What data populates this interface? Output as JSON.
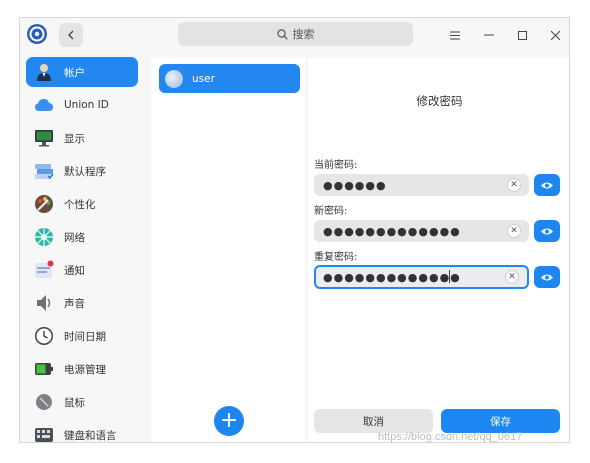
{
  "titlebar": {
    "search_placeholder": "搜索",
    "back_icon": "chevron-left-icon",
    "menu_icon": "menu-icon",
    "minimize_icon": "minimize-icon",
    "maximize_icon": "maximize-icon",
    "close_icon": "close-icon"
  },
  "sidebar": {
    "items": [
      {
        "label": "帐户",
        "icon": "account-icon",
        "active": true
      },
      {
        "label": "Union ID",
        "icon": "cloud-icon"
      },
      {
        "label": "显示",
        "icon": "display-icon"
      },
      {
        "label": "默认程序",
        "icon": "default-apps-icon"
      },
      {
        "label": "个性化",
        "icon": "personalization-icon"
      },
      {
        "label": "网络",
        "icon": "network-icon"
      },
      {
        "label": "通知",
        "icon": "notification-icon"
      },
      {
        "label": "声音",
        "icon": "sound-icon"
      },
      {
        "label": "时间日期",
        "icon": "clock-icon"
      },
      {
        "label": "电源管理",
        "icon": "power-icon"
      },
      {
        "label": "鼠标",
        "icon": "mouse-icon"
      },
      {
        "label": "键盘和语言",
        "icon": "keyboard-icon"
      }
    ]
  },
  "users": {
    "list": [
      {
        "name": "user"
      }
    ],
    "add_label": "+"
  },
  "detail": {
    "title": "修改密码",
    "fields": [
      {
        "label": "当前密码:",
        "value": "●●●●●●"
      },
      {
        "label": "新密码:",
        "value": "●●●●●●●●●●●●●"
      },
      {
        "label": "重复密码:",
        "value": "●●●●●●●●●●●●●"
      }
    ],
    "cancel_label": "取消",
    "save_label": "保存"
  },
  "watermark": "https://blog.csdn.net/qq_0617",
  "colors": {
    "accent": "#2288f0",
    "window_bg": "#f7f7f7",
    "panel_bg": "#ffffff",
    "field_bg": "#e6e6e6"
  }
}
